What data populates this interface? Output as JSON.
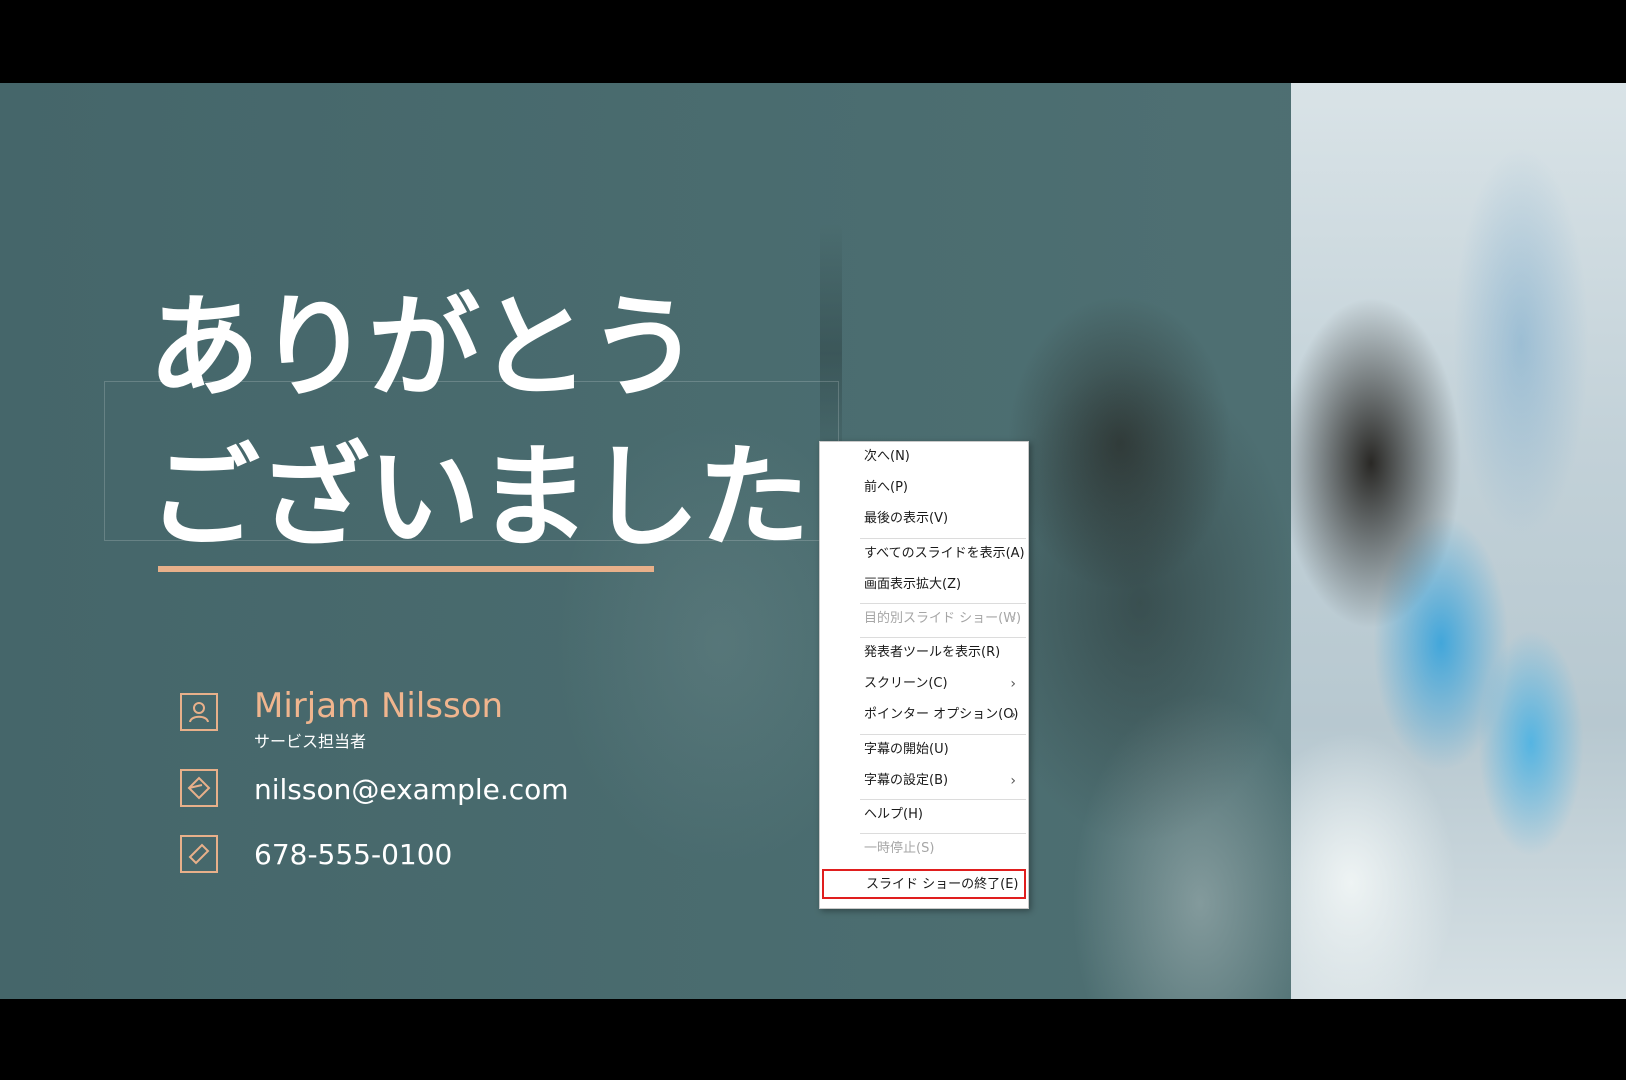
{
  "slide": {
    "title_line1": "ありがとう",
    "title_line2": "ございました",
    "contact": {
      "name": "Mirjam Nilsson",
      "role": "サービス担当者",
      "email": "nilsson@example.com",
      "phone": "678-555-0100"
    },
    "accent_color": "#e8b08a"
  },
  "context_menu": {
    "items": [
      {
        "label": "次へ(N)",
        "enabled": true,
        "submenu": false
      },
      {
        "label": "前へ(P)",
        "enabled": true,
        "submenu": false
      },
      {
        "label": "最後の表示(V)",
        "enabled": true,
        "submenu": false
      },
      {
        "label": "すべてのスライドを表示(A)",
        "enabled": true,
        "submenu": false
      },
      {
        "label": "画面表示拡大(Z)",
        "enabled": true,
        "submenu": false
      },
      {
        "label": "目的別スライド ショー(W)",
        "enabled": false,
        "submenu": true
      },
      {
        "label": "発表者ツールを表示(R)",
        "enabled": true,
        "submenu": false
      },
      {
        "label": "スクリーン(C)",
        "enabled": true,
        "submenu": true
      },
      {
        "label": "ポインター オプション(O)",
        "enabled": true,
        "submenu": true
      },
      {
        "label": "字幕の開始(U)",
        "enabled": true,
        "submenu": false
      },
      {
        "label": "字幕の設定(B)",
        "enabled": true,
        "submenu": true
      },
      {
        "label": "ヘルプ(H)",
        "enabled": true,
        "submenu": false
      },
      {
        "label": "一時停止(S)",
        "enabled": false,
        "submenu": false
      },
      {
        "label": "スライド ショーの終了(E)",
        "enabled": true,
        "submenu": false,
        "highlighted": true
      }
    ],
    "submenu_arrow": "›",
    "highlight_color": "#e01e1e"
  }
}
